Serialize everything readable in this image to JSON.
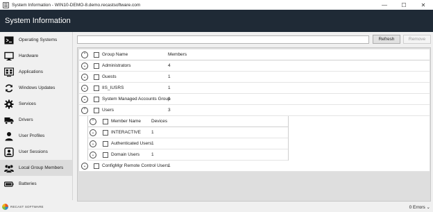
{
  "window": {
    "title": "System Information - WIN10-DEMO-8.demo.recastsoftware.com",
    "minimize": "—",
    "maximize": "☐",
    "close": "✕"
  },
  "header": {
    "title": "System Information"
  },
  "sidebar": {
    "items": [
      {
        "label": "Operating Systems",
        "icon": "terminal-icon"
      },
      {
        "label": "Hardware",
        "icon": "monitor-icon"
      },
      {
        "label": "Applications",
        "icon": "applications-icon"
      },
      {
        "label": "Windows Updates",
        "icon": "refresh-icon"
      },
      {
        "label": "Services",
        "icon": "gear-icon"
      },
      {
        "label": "Drivers",
        "icon": "truck-icon"
      },
      {
        "label": "User Profiles",
        "icon": "user-icon"
      },
      {
        "label": "User Sessions",
        "icon": "user-session-icon"
      },
      {
        "label": "Local Group Members",
        "icon": "users-icon"
      },
      {
        "label": "Batteries",
        "icon": "battery-icon"
      }
    ],
    "active_index": 8
  },
  "toolbar": {
    "search_value": "",
    "refresh_label": "Refresh",
    "remove_label": "Remove"
  },
  "grid": {
    "columns": {
      "name": "Group Name",
      "members": "Members"
    },
    "rows": [
      {
        "name": "Administrators",
        "members": "4"
      },
      {
        "name": "Guests",
        "members": "1"
      },
      {
        "name": "IIS_IUSRS",
        "members": "1"
      },
      {
        "name": "System Managed Accounts Group",
        "members": "1"
      },
      {
        "name": "Users",
        "members": "3"
      },
      {
        "name": "ConfigMgr Remote Control Users",
        "members": "1"
      }
    ],
    "expanded_row": "Users",
    "subgrid": {
      "columns": {
        "name": "Member Name",
        "devices": "Devices"
      },
      "rows": [
        {
          "name": "INTERACTIVE",
          "devices": "1"
        },
        {
          "name": "Authenticated Users",
          "devices": "1"
        },
        {
          "name": "Domain Users",
          "devices": "1"
        }
      ]
    }
  },
  "status": {
    "logo_text": "RECAST SOFTWARE",
    "errors": "0 Errors",
    "errors_arrow": "⌄"
  },
  "colors": {
    "header_bg": "#1f2a36",
    "sidebar_active": "#dcdcdc",
    "logo_orange": "#e8561f",
    "logo_blue": "#2e8bc9",
    "logo_green": "#7bbf3e",
    "logo_yellow": "#f3b21b"
  }
}
